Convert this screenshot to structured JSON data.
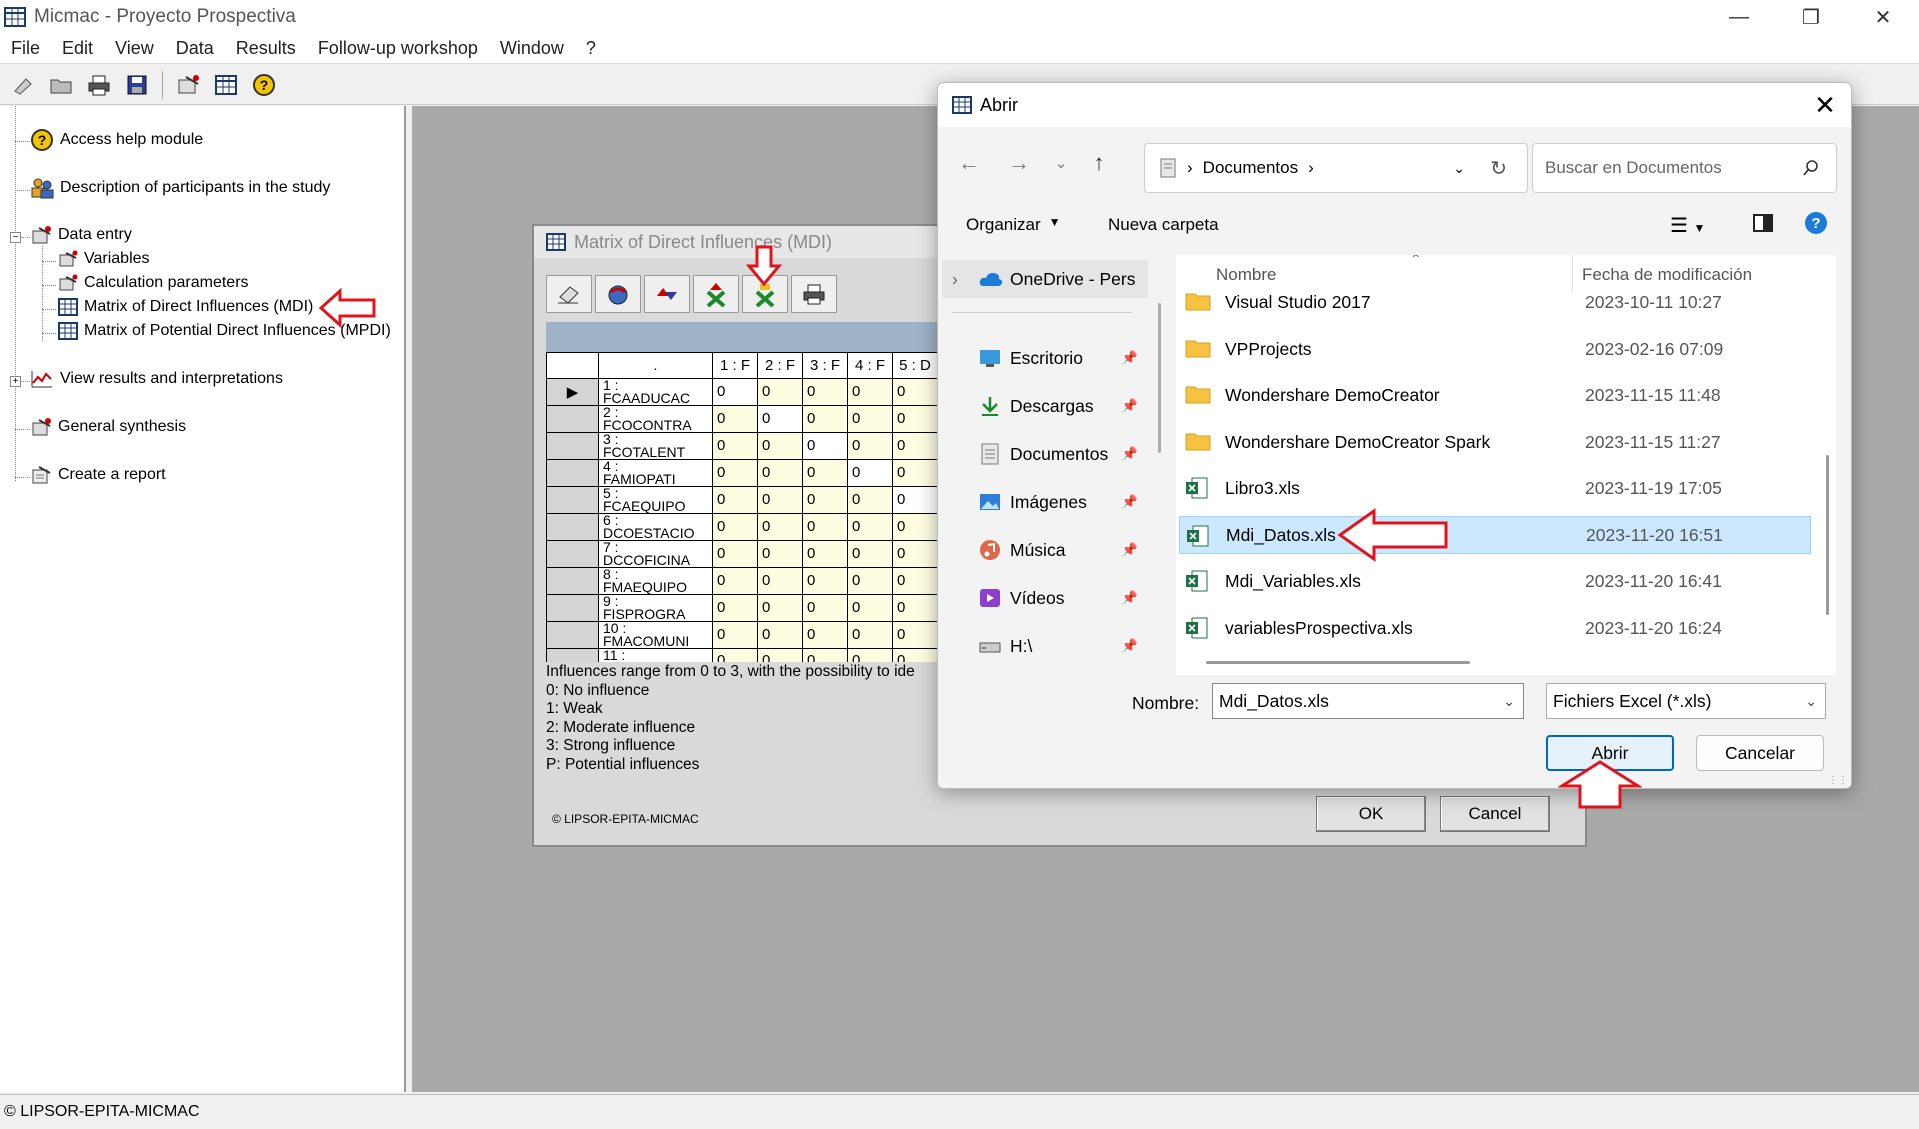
{
  "app": {
    "title": "Micmac  -  Proyecto Prospectiva",
    "menu": [
      "File",
      "Edit",
      "View",
      "Data",
      "Results",
      "Follow-up workshop",
      "Window",
      "?"
    ],
    "status": "© LIPSOR-EPITA-MICMAC"
  },
  "tree": {
    "items": [
      {
        "label": "Access help module"
      },
      {
        "label": "Description of participants in the study"
      },
      {
        "label": "Data entry"
      },
      {
        "label": "Variables"
      },
      {
        "label": "Calculation parameters"
      },
      {
        "label": "Matrix of Direct Influences (MDI)"
      },
      {
        "label": "Matrix of Potential Direct Influences (MPDI)"
      },
      {
        "label": "View results and interpretations"
      },
      {
        "label": "General synthesis"
      },
      {
        "label": "Create a report"
      }
    ]
  },
  "mdi": {
    "title": "Matrix of Direct Influences (MDI)",
    "columns": [
      ".",
      "1 : F",
      "2 : F",
      "3 : F",
      "4 : F",
      "5 : D"
    ],
    "rows": [
      {
        "label": "1 :",
        "sub": "FCAADUCAC",
        "values": [
          "0",
          "0",
          "0",
          "0",
          "0"
        ]
      },
      {
        "label": "2 :",
        "sub": "FCOCONTRA",
        "values": [
          "0",
          "0",
          "0",
          "0",
          "0"
        ]
      },
      {
        "label": "3 :",
        "sub": "FCOTALENT",
        "values": [
          "0",
          "0",
          "0",
          "0",
          "0"
        ]
      },
      {
        "label": "4 :",
        "sub": "FAMIOPATI",
        "values": [
          "0",
          "0",
          "0",
          "0",
          "0"
        ]
      },
      {
        "label": "5 :",
        "sub": "FCAEQUIPO",
        "values": [
          "0",
          "0",
          "0",
          "0",
          "0"
        ]
      },
      {
        "label": "6 :",
        "sub": "DCOESTACIO",
        "values": [
          "0",
          "0",
          "0",
          "0",
          "0"
        ]
      },
      {
        "label": "7 :",
        "sub": "DCCOFICINA",
        "values": [
          "0",
          "0",
          "0",
          "0",
          "0"
        ]
      },
      {
        "label": "8 :",
        "sub": "FMAEQUIPO",
        "values": [
          "0",
          "0",
          "0",
          "0",
          "0"
        ]
      },
      {
        "label": "9 :",
        "sub": "FISPROGRA",
        "values": [
          "0",
          "0",
          "0",
          "0",
          "0"
        ]
      },
      {
        "label": "10 :",
        "sub": "FMACOMUNI",
        "values": [
          "0",
          "0",
          "0",
          "0",
          "0"
        ]
      },
      {
        "label": "11 :",
        "sub": "",
        "values": [
          "0",
          "0",
          "0",
          "0",
          "0"
        ]
      }
    ],
    "legend": [
      "Influences range from 0 to 3, with the possibility to ide",
      " 0: No influence",
      "1: Weak",
      "2: Moderate influence",
      "3: Strong influence",
      "P: Potential influences"
    ],
    "copyright": "© LIPSOR-EPITA-MICMAC",
    "ok": "OK",
    "cancel": "Cancel"
  },
  "dialog": {
    "title": "Abrir",
    "address": "Documentos",
    "search_placeholder": "Buscar en Documentos",
    "organize": "Organizar",
    "new_folder": "Nueva carpeta",
    "nav": [
      {
        "label": "OneDrive - Pers",
        "icon": "cloud-icon"
      },
      {
        "label": "Escritorio",
        "icon": "desktop-icon"
      },
      {
        "label": "Descargas",
        "icon": "download-icon"
      },
      {
        "label": "Documentos",
        "icon": "documents-icon"
      },
      {
        "label": "Imágenes",
        "icon": "images-icon"
      },
      {
        "label": "Música",
        "icon": "music-icon"
      },
      {
        "label": "Vídeos",
        "icon": "videos-icon"
      },
      {
        "label": "H:\\",
        "icon": "drive-icon"
      }
    ],
    "col_name": "Nombre",
    "col_date": "Fecha de modificación",
    "files": [
      {
        "name": "Visual Studio 2017",
        "date": "2023-10-11 10:27",
        "type": "folder"
      },
      {
        "name": "VPProjects",
        "date": "2023-02-16 07:09",
        "type": "folder"
      },
      {
        "name": "Wondershare DemoCreator",
        "date": "2023-11-15 11:48",
        "type": "folder"
      },
      {
        "name": "Wondershare DemoCreator Spark",
        "date": "2023-11-15 11:27",
        "type": "folder"
      },
      {
        "name": "Libro3.xls",
        "date": "2023-11-19 17:05",
        "type": "excel"
      },
      {
        "name": "Mdi_Datos.xls",
        "date": "2023-11-20 16:51",
        "type": "excel",
        "selected": true
      },
      {
        "name": "Mdi_Variables.xls",
        "date": "2023-11-20 16:41",
        "type": "excel"
      },
      {
        "name": "variablesProspectiva.xls",
        "date": "2023-11-20 16:24",
        "type": "excel"
      }
    ],
    "filename_label": "Nombre:",
    "filename_value": "Mdi_Datos.xls",
    "filetype": "Fichiers Excel (*.xls)",
    "open": "Abrir",
    "cancel": "Cancelar"
  },
  "colors": {
    "annotation": "#e0141c",
    "accent": "#0067c0",
    "selection": "#cce8ff",
    "folder": "#f5c242",
    "excel": "#1d7145"
  }
}
